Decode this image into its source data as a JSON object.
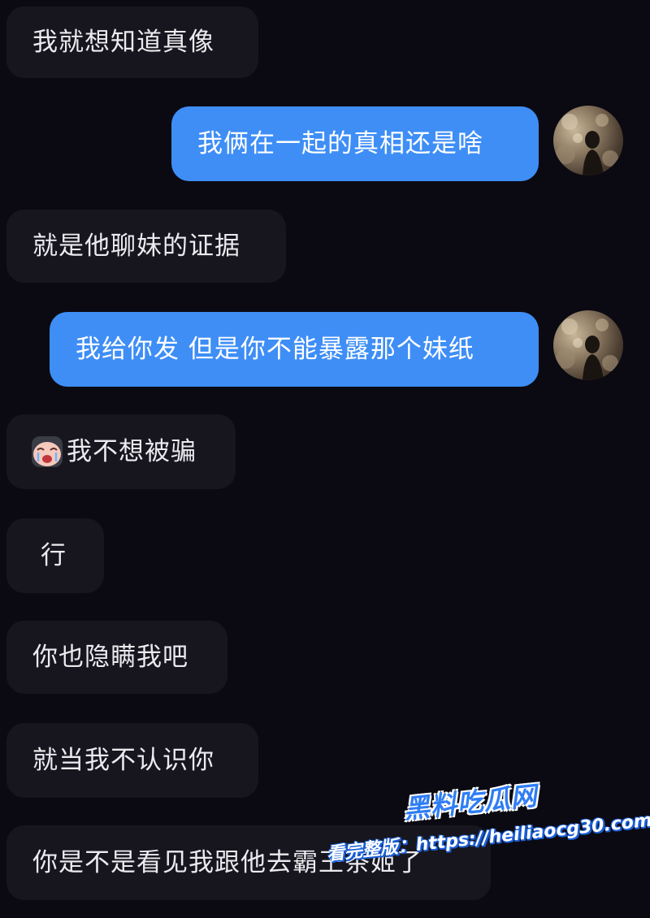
{
  "conversation": {
    "messages": [
      {
        "direction": "received",
        "text": "我就想知道真像"
      },
      {
        "direction": "sent",
        "text": "我俩在一起的真相还是啥"
      },
      {
        "direction": "received",
        "text": "就是他聊妹的证据"
      },
      {
        "direction": "sent",
        "text": "我给你发 但是你不能暴露那个妹纸"
      },
      {
        "direction": "received",
        "text": "我不想被骗",
        "emoji": "crying-face-icon"
      },
      {
        "direction": "received",
        "text": "行"
      },
      {
        "direction": "received",
        "text": "你也隐瞒我吧"
      },
      {
        "direction": "received",
        "text": "就当我不认识你"
      },
      {
        "direction": "received",
        "text": "你是不是看见我跟他去霸王茶姬了"
      }
    ]
  },
  "watermark": {
    "logo": "黑料吃瓜网",
    "url_text": "看完整版：https://heiliaocg30.com"
  },
  "colors": {
    "background": "#0b0a12",
    "received_bubble": "#17161e",
    "sent_bubble": "#3e8ef6",
    "watermark_blue": "#2f7df5"
  }
}
